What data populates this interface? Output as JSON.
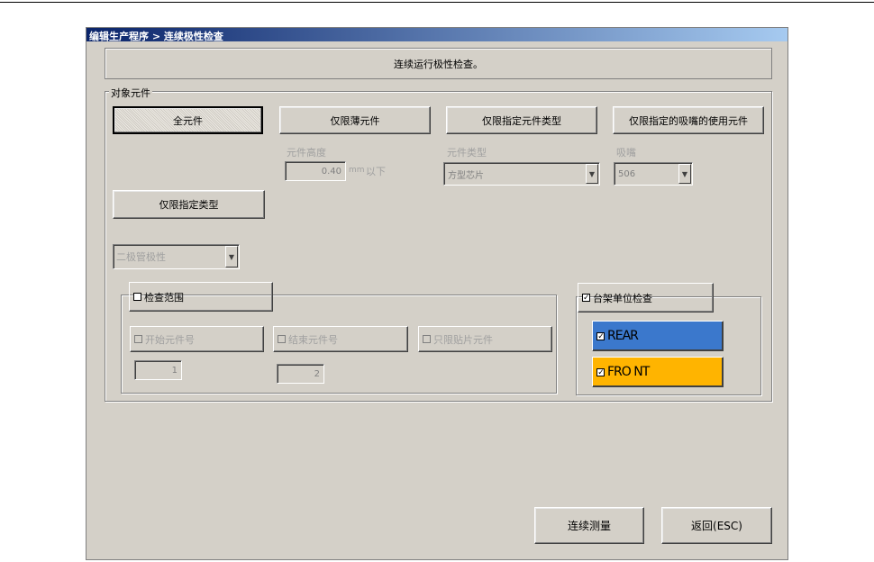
{
  "window": {
    "title": "编辑生产程序 > 连续极性检查"
  },
  "message": "连续运行极性检查。",
  "target_group": {
    "label": "对象元件",
    "buttons": {
      "all": "全元件",
      "thin": "仅限薄元件",
      "by_type": "仅限指定元件类型",
      "by_nozzle": "仅限指定的吸嘴的使用元件",
      "by_kind": "仅限指定类型"
    },
    "height": {
      "label": "元件高度",
      "value": "0.40",
      "unit": "mm",
      "suffix": "以下"
    },
    "part_type": {
      "label": "元件类型",
      "value": "方型芯片"
    },
    "nozzle": {
      "label": "吸嘴",
      "value": "506"
    },
    "kind_select": {
      "value": "二极管极性"
    }
  },
  "range_group": {
    "label": "检查范围",
    "checked": false,
    "start": {
      "label": "开始元件号",
      "value": "1"
    },
    "end": {
      "label": "结束元件号",
      "value": "2"
    },
    "only_mount": {
      "label": "只限贴片元件"
    }
  },
  "table_group": {
    "label": "台架单位检查",
    "checked": true,
    "rear": {
      "label": "REAR",
      "checked": true,
      "color": "#3b78cc"
    },
    "front": {
      "label": "FRO NT",
      "checked": true,
      "color": "#ffb400"
    }
  },
  "footer": {
    "run": "连续测量",
    "back": "返回(ESC)"
  }
}
